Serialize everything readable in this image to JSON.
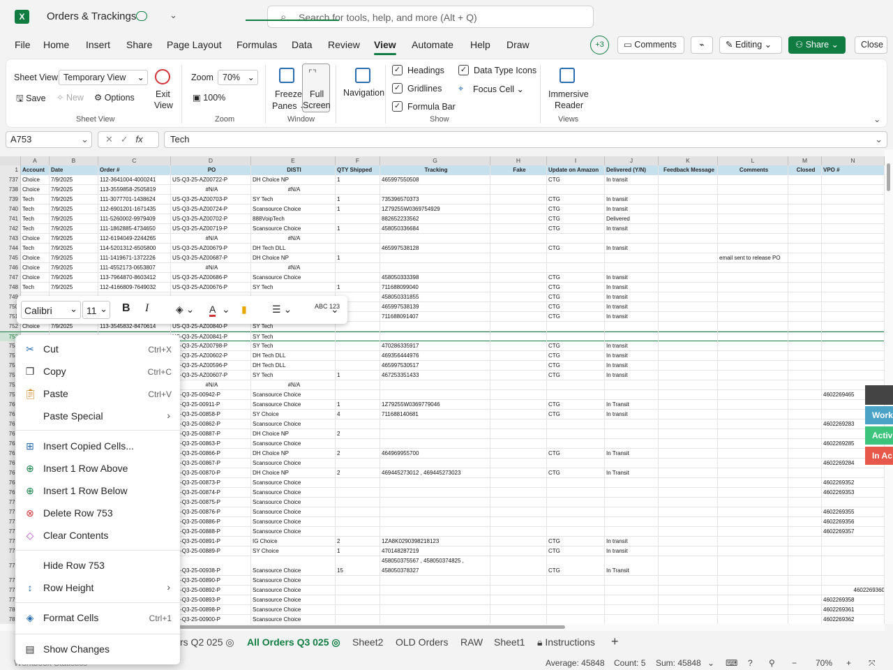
{
  "title": {
    "app_icon": "excel-icon",
    "doc_name": "Orders & Trackings"
  },
  "search": {
    "placeholder": "Search for tools, help, and more (Alt + Q)"
  },
  "menu": {
    "items": [
      "File",
      "Home",
      "Insert",
      "Share",
      "Page Layout",
      "Formulas",
      "Data",
      "Review",
      "View",
      "Automate",
      "Help",
      "Draw"
    ],
    "active": "View",
    "collab_count": "+3",
    "comments": "Comments",
    "editing": "Editing",
    "share": "Share",
    "close": "Close"
  },
  "ribbon": {
    "sheet_view_label": "Sheet View",
    "sheet_view_value": "Temporary View",
    "save": "Save",
    "new": "New",
    "options": "Options",
    "exit_view": [
      "Exit",
      "View"
    ],
    "group_sheet_view": "Sheet View",
    "zoom_label": "Zoom",
    "zoom_value": "70%",
    "zoom_100": "100%",
    "group_zoom": "Zoom",
    "freeze": [
      "Freeze",
      "Panes"
    ],
    "full_screen": [
      "Full",
      "Screen"
    ],
    "group_window": "Window",
    "navigation": "Navigation",
    "headings": "Headings",
    "gridlines": "Gridlines",
    "formula_bar": "Formula Bar",
    "data_type_icons": "Data Type Icons",
    "focus_cell": "Focus Cell",
    "group_show": "Show",
    "immersive": [
      "Immersive",
      "Reader"
    ],
    "group_views": "Views"
  },
  "formula": {
    "namebox": "A753",
    "value": "Tech"
  },
  "columns": [
    "A",
    "B",
    "C",
    "D",
    "E",
    "F",
    "G",
    "H",
    "I",
    "J",
    "K",
    "L",
    "M",
    "N"
  ],
  "headers": [
    "Account",
    "Date",
    "Order #",
    "PO",
    "DISTI",
    "QTY Shipped",
    "Tracking",
    "Fake",
    "Update on Amazon",
    "Delivered (Y/N)",
    "Feedback Message",
    "Comments",
    "Closed",
    "VPO #"
  ],
  "rows": [
    {
      "n": "737",
      "c": [
        "Choice",
        "7/9/2025",
        "112-3641004-4000241",
        "US-Q3-25-AZ00722-P",
        "DH Choice NP",
        "1",
        "465997550508",
        "",
        "CTG",
        "In transit",
        "",
        "",
        "",
        ""
      ]
    },
    {
      "n": "738",
      "c": [
        "Choice",
        "7/9/2025",
        "113-3559858-2505819",
        "#N/A",
        "#N/A",
        "",
        "",
        "",
        "",
        "",
        "",
        "",
        "",
        ""
      ]
    },
    {
      "n": "739",
      "c": [
        "Tech",
        "7/9/2025",
        "111-3077701-1438624",
        "US-Q3-25-AZ00703-P",
        "SY Tech",
        "1",
        "735396570373",
        "",
        "CTG",
        "In transit",
        "",
        "",
        "",
        ""
      ]
    },
    {
      "n": "740",
      "c": [
        "Tech",
        "7/9/2025",
        "112-6901201-1671435",
        "US-Q3-25-AZ00724-P",
        "Scansource Choice",
        "1",
        "1Z79255W0369754929",
        "",
        "CTG",
        "In transit",
        "",
        "",
        "",
        ""
      ]
    },
    {
      "n": "741",
      "c": [
        "Tech",
        "7/9/2025",
        "111-5260002-9979409",
        "US-Q3-25-AZ00702-P",
        "888VoipTech",
        "",
        "882652233562",
        "",
        "CTG",
        "Delivered",
        "",
        "",
        "",
        ""
      ]
    },
    {
      "n": "742",
      "c": [
        "Tech",
        "7/9/2025",
        "111-1862885-4734650",
        "US-Q3-25-AZ00719-P",
        "Scansource Choice",
        "1",
        "458050336684",
        "",
        "CTG",
        "In transit",
        "",
        "",
        "",
        ""
      ]
    },
    {
      "n": "743",
      "c": [
        "Choice",
        "7/9/2025",
        "112-6194049-2244265",
        "#N/A",
        "#N/A",
        "",
        "",
        "",
        "",
        "",
        "",
        "",
        "",
        ""
      ]
    },
    {
      "n": "744",
      "c": [
        "Tech",
        "7/9/2025",
        "114-5201312-6505800",
        "US-Q3-25-AZ00679-P",
        "DH Tech DLL",
        "",
        "465997538128",
        "",
        "CTG",
        "In transit",
        "",
        "",
        "",
        ""
      ]
    },
    {
      "n": "745",
      "c": [
        "Choice",
        "7/9/2025",
        "111-1419671-1372226",
        "US-Q3-25-AZ00687-P",
        "DH Choice NP",
        "1",
        "",
        "",
        "",
        "",
        "",
        "email sent to release PO",
        "",
        ""
      ]
    },
    {
      "n": "746",
      "c": [
        "Choice",
        "7/9/2025",
        "111-4552173-0653807",
        "#N/A",
        "#N/A",
        "",
        "",
        "",
        "",
        "",
        "",
        "",
        "",
        ""
      ]
    },
    {
      "n": "747",
      "c": [
        "Choice",
        "7/9/2025",
        "113-7964870-8603412",
        "US-Q3-25-AZ00686-P",
        "Scansource Choice",
        "",
        "458050333398",
        "",
        "CTG",
        "In transit",
        "",
        "",
        "",
        ""
      ]
    },
    {
      "n": "748",
      "c": [
        "Tech",
        "7/9/2025",
        "112-4166809-7649032",
        "US-Q3-25-AZ00676-P",
        "SY Tech",
        "1",
        "711688099040",
        "",
        "CTG",
        "In transit",
        "",
        "",
        "",
        ""
      ]
    },
    {
      "n": "749",
      "c": [
        "",
        "",
        "",
        "",
        "",
        "",
        "458050331855",
        "",
        "CTG",
        "In transit",
        "",
        "",
        "",
        ""
      ]
    },
    {
      "n": "750",
      "c": [
        "",
        "",
        "",
        "",
        "",
        "",
        "465997538139",
        "",
        "CTG",
        "In transit",
        "",
        "",
        "",
        ""
      ]
    },
    {
      "n": "751",
      "c": [
        "",
        "",
        "",
        "",
        "",
        "",
        "711688091407",
        "",
        "CTG",
        "In transit",
        "",
        "",
        "",
        ""
      ]
    },
    {
      "n": "752",
      "c": [
        "Choice",
        "7/9/2025",
        "113-3545832-8470614",
        "US-Q3-25-AZ00840-P",
        "SY Tech",
        "",
        "",
        "",
        "",
        "",
        "",
        "",
        "",
        ""
      ]
    },
    {
      "n": "753",
      "c": [
        "",
        "",
        "",
        "US-Q3-25-AZ00841-P",
        "SY Tech",
        "",
        "",
        "",
        "",
        "",
        "",
        "",
        "",
        ""
      ]
    },
    {
      "n": "754",
      "c": [
        "",
        "",
        "",
        "US-Q3-25-AZ00798-P",
        "SY Tech",
        "",
        "470286335917",
        "",
        "CTG",
        "In transit",
        "",
        "",
        "",
        ""
      ]
    },
    {
      "n": "755",
      "c": [
        "",
        "",
        "",
        "US-Q3-25-AZ00602-P",
        "DH Tech DLL",
        "",
        "469356444976",
        "",
        "CTG",
        "In transit",
        "",
        "",
        "",
        ""
      ]
    },
    {
      "n": "756",
      "c": [
        "",
        "",
        "",
        "US-Q3-25-AZ00596-P",
        "DH Tech DLL",
        "",
        "465997530517",
        "",
        "CTG",
        "In transit",
        "",
        "",
        "",
        ""
      ]
    },
    {
      "n": "757",
      "c": [
        "",
        "",
        "",
        "US-Q3-25-AZ00607-P",
        "SY Tech",
        "1",
        "467253351433",
        "",
        "CTG",
        "In transit",
        "",
        "",
        "",
        ""
      ]
    },
    {
      "n": "758",
      "c": [
        "",
        "",
        "",
        "#N/A",
        "#N/A",
        "",
        "",
        "",
        "",
        "",
        "",
        "",
        "",
        ""
      ]
    },
    {
      "n": "759",
      "c": [
        "",
        "",
        "",
        "US-Q3-25-00942-P",
        "Scansource Choice",
        "",
        "",
        "",
        "",
        "",
        "",
        "",
        "",
        "4602269465"
      ]
    },
    {
      "n": "760",
      "c": [
        "",
        "",
        "",
        "US-Q3-25-00911-P",
        "Scansource Choice",
        "1",
        "1Z79255W0369779046",
        "",
        "CTG",
        "In Transit",
        "",
        "",
        "",
        ""
      ]
    },
    {
      "n": "761",
      "c": [
        "",
        "",
        "",
        "US-Q3-25-00858-P",
        "SY Choice",
        "4",
        "711688140681",
        "",
        "CTG",
        "In transit",
        "",
        "",
        "",
        ""
      ]
    },
    {
      "n": "762",
      "c": [
        "",
        "",
        "",
        "US-Q3-25-00862-P",
        "Scansource Choice",
        "",
        "",
        "",
        "",
        "",
        "",
        "",
        "",
        "4602269283"
      ]
    },
    {
      "n": "763",
      "c": [
        "",
        "",
        "",
        "US-Q3-25-00887-P",
        "DH Choice NP",
        "2",
        "",
        "",
        "",
        "",
        "",
        "",
        "",
        ""
      ]
    },
    {
      "n": "764",
      "c": [
        "",
        "",
        "",
        "US-Q3-25-00863-P",
        "Scansource Choice",
        "",
        "",
        "",
        "",
        "",
        "",
        "",
        "",
        "4602269285"
      ]
    },
    {
      "n": "765",
      "c": [
        "",
        "",
        "",
        "US-Q3-25-00866-P",
        "DH Choice NP",
        "2",
        "464969955700",
        "",
        "CTG",
        "In Transit",
        "",
        "",
        "",
        ""
      ]
    },
    {
      "n": "766",
      "c": [
        "",
        "",
        "",
        "US-Q3-25-00867-P",
        "Scansource Choice",
        "",
        "",
        "",
        "",
        "",
        "",
        "",
        "",
        "4602269284"
      ]
    },
    {
      "n": "767",
      "c": [
        "",
        "",
        "",
        "US-Q3-25-00870-P",
        "DH Choice NP",
        "2",
        "469445273012 , 469445273023",
        "",
        "CTG",
        "In Transit",
        "",
        "",
        "",
        ""
      ]
    },
    {
      "n": "768",
      "c": [
        "",
        "",
        "",
        "US-Q3-25-00873-P",
        "Scansource Choice",
        "",
        "",
        "",
        "",
        "",
        "",
        "",
        "",
        "4602269352"
      ]
    },
    {
      "n": "769",
      "c": [
        "",
        "",
        "",
        "US-Q3-25-00874-P",
        "Scansource Choice",
        "",
        "",
        "",
        "",
        "",
        "",
        "",
        "",
        "4602269353"
      ]
    },
    {
      "n": "770",
      "c": [
        "",
        "",
        "",
        "US-Q3-25-00875-P",
        "Scansource Choice",
        "",
        "",
        "",
        "",
        "",
        "",
        "",
        "",
        ""
      ]
    },
    {
      "n": "771",
      "c": [
        "",
        "",
        "",
        "US-Q3-25-00876-P",
        "Scansource Choice",
        "",
        "",
        "",
        "",
        "",
        "",
        "",
        "",
        "4602269355"
      ]
    },
    {
      "n": "772",
      "c": [
        "",
        "",
        "",
        "US-Q3-25-00886-P",
        "Scansource Choice",
        "",
        "",
        "",
        "",
        "",
        "",
        "",
        "",
        "4602269356"
      ]
    },
    {
      "n": "773",
      "c": [
        "",
        "",
        "",
        "US-Q3-25-00888-P",
        "Scansource Choice",
        "",
        "",
        "",
        "",
        "",
        "",
        "",
        "",
        "4602269357"
      ]
    },
    {
      "n": "774",
      "c": [
        "",
        "",
        "",
        "US-Q3-25-00891-P",
        "IG Choice",
        "2",
        "1ZA8K0290398218123",
        "",
        "CTG",
        "In transit",
        "",
        "",
        "",
        ""
      ]
    },
    {
      "n": "775",
      "c": [
        "",
        "",
        "",
        "US-Q3-25-00889-P",
        "SY Choice",
        "1",
        "470148287219",
        "",
        "CTG",
        "In transit",
        "",
        "",
        "",
        ""
      ]
    },
    {
      "n": "776",
      "c": [
        "",
        "",
        "",
        "US-Q3-25-00938-P",
        "Scansource Choice",
        "15",
        "458050375567 , 458050374825 , 458050378327",
        "",
        "CTG",
        "In Transit",
        "",
        "",
        "",
        ""
      ]
    },
    {
      "n": "777",
      "c": [
        "",
        "",
        "",
        "US-Q3-25-00890-P",
        "Scansource Choice",
        "",
        "",
        "",
        "",
        "",
        "",
        "",
        "",
        ""
      ]
    },
    {
      "n": "778",
      "c": [
        "",
        "",
        "",
        "US-Q3-25-00892-P",
        "Scansource Choice",
        "",
        "",
        "",
        "",
        "",
        "",
        "",
        "",
        "4602269360"
      ]
    },
    {
      "n": "779",
      "c": [
        "",
        "",
        "",
        "US-Q3-25-00893-P",
        "Scansource Choice",
        "",
        "",
        "",
        "",
        "",
        "",
        "",
        "",
        "4602269358"
      ]
    },
    {
      "n": "780",
      "c": [
        "",
        "",
        "",
        "US-Q3-25-00898-P",
        "Scansource Choice",
        "",
        "",
        "",
        "",
        "",
        "",
        "",
        "",
        "4602269361"
      ]
    },
    {
      "n": "781",
      "c": [
        "",
        "",
        "",
        "US-Q3-25-00900-P",
        "Scansource Choice",
        "",
        "",
        "",
        "",
        "",
        "",
        "",
        "",
        "4602269362"
      ]
    }
  ],
  "float_toolbar": {
    "font": "Calibri",
    "size": "11",
    "bold": "B",
    "italic": "I",
    "spell": "ABC 123"
  },
  "context_menu": {
    "cut": "Cut",
    "cut_key": "Ctrl+X",
    "copy": "Copy",
    "copy_key": "Ctrl+C",
    "paste": "Paste",
    "paste_key": "Ctrl+V",
    "paste_special": "Paste Special",
    "insert_copied": "Insert Copied Cells...",
    "insert_above": "Insert 1 Row Above",
    "insert_below": "Insert 1 Row Below",
    "delete_row": "Delete Row 753",
    "clear": "Clear Contents",
    "hide_row": "Hide Row 753",
    "row_height": "Row Height",
    "format_cells": "Format Cells",
    "format_key": "Ctrl+1",
    "show_changes": "Show Changes"
  },
  "side_badges": [
    "Work",
    "Activ",
    "In Ac"
  ],
  "tabs": {
    "items": [
      "rs Q2 025",
      "All Orders Q3 025",
      "Sheet2",
      "OLD Orders",
      "RAW",
      "Sheet1",
      "Instructions"
    ],
    "active": "All Orders Q3 025"
  },
  "status": {
    "left": "Workbook Statistics",
    "average": "Average: 45848",
    "count": "Count: 5",
    "sum": "Sum: 45848",
    "zoom": "70%"
  }
}
